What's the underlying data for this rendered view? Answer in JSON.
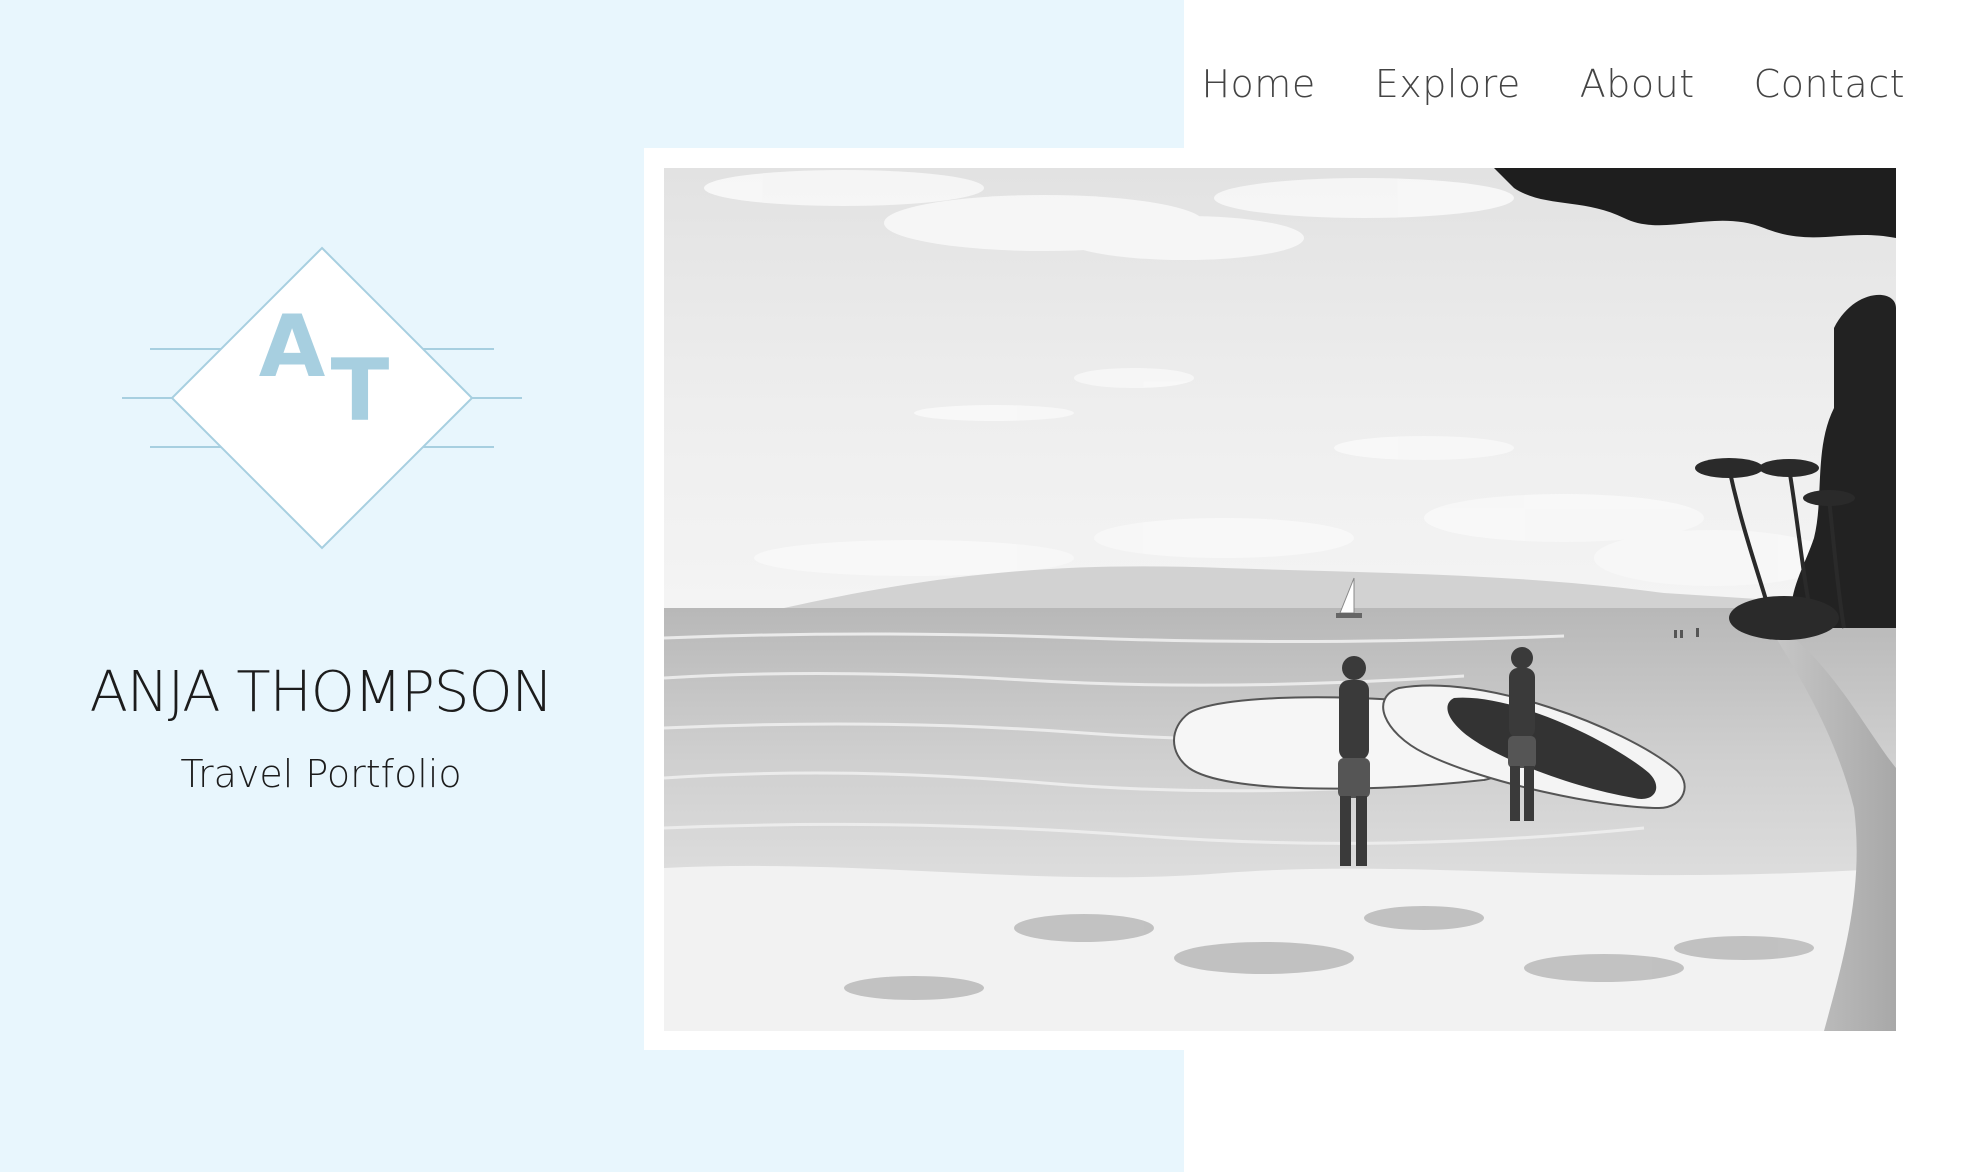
{
  "nav": {
    "items": [
      {
        "label": "Home"
      },
      {
        "label": "Explore"
      },
      {
        "label": "About"
      },
      {
        "label": "Contact"
      }
    ]
  },
  "brand": {
    "monogram_first": "A",
    "monogram_second": "T",
    "name": "ANJA THOMPSON",
    "subtitle": "Travel Portfolio"
  },
  "colors": {
    "panel_background": "#e8f6fd",
    "logo_accent": "#a7cfe0",
    "text_dark": "#1c1c1c",
    "nav_text": "#444444"
  },
  "hero": {
    "image_subject": "black-and-white beach photo of two surfers carrying surfboards in the shallow waves"
  }
}
